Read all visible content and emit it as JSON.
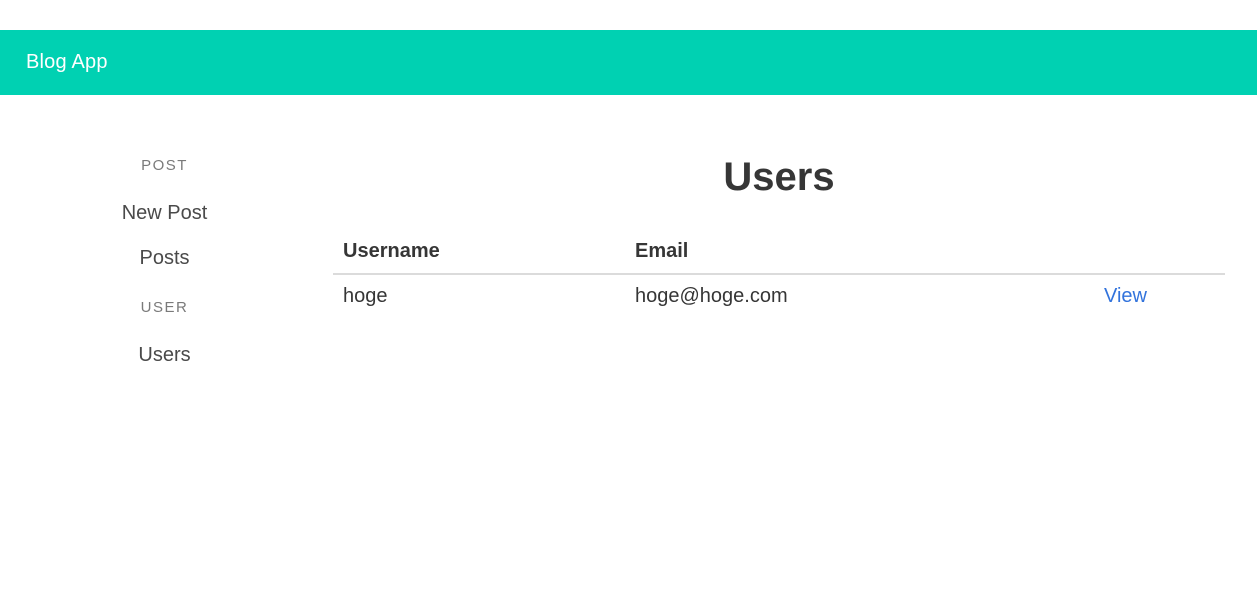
{
  "app": {
    "brand": "Blog App"
  },
  "sidebar": {
    "sections": [
      {
        "label": "POST",
        "items": [
          "New Post",
          "Posts"
        ]
      },
      {
        "label": "USER",
        "items": [
          "Users"
        ]
      }
    ]
  },
  "main": {
    "title": "Users",
    "table": {
      "columns": [
        "Username",
        "Email",
        ""
      ],
      "rows": [
        {
          "username": "hoge",
          "email": "hoge@hoge.com",
          "action": "View"
        }
      ]
    }
  },
  "colors": {
    "navbar": "#00d1b2",
    "link": "#3273dc",
    "text": "#363636",
    "menu_label": "#7a7a7a"
  }
}
